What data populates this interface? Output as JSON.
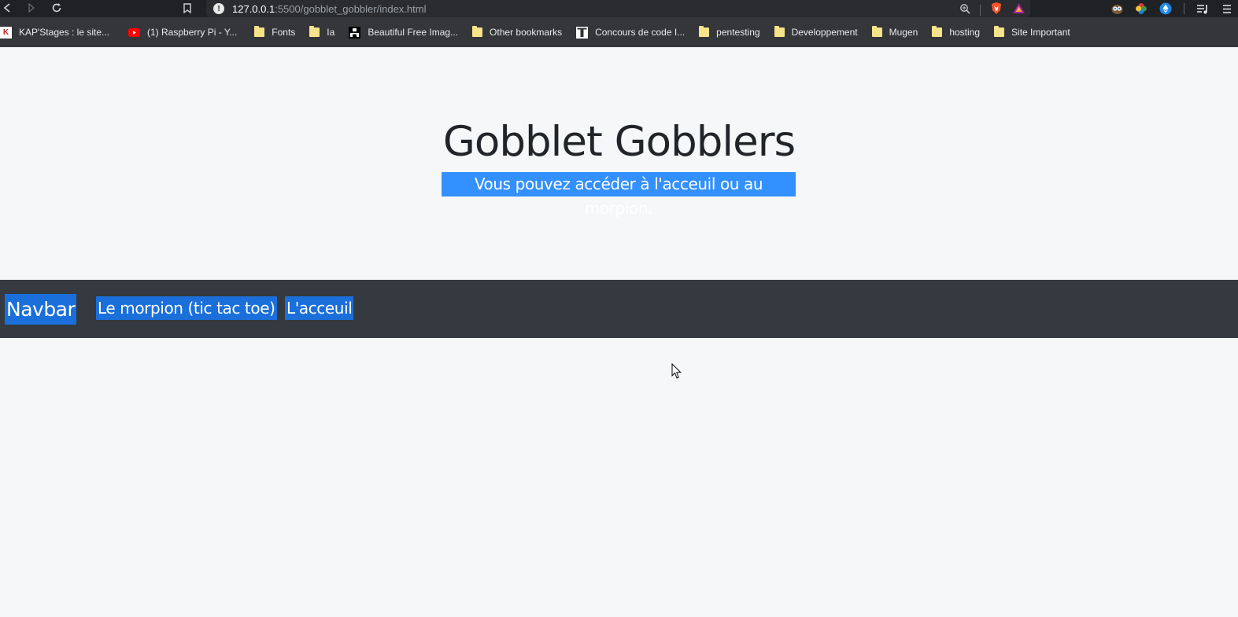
{
  "browser": {
    "url_host": "127.0.0.1",
    "url_rest": ":5500/gobblet_gobbler/index.html",
    "icons": {
      "back": "back-arrow-icon",
      "forward": "forward-arrow-icon",
      "reload": "reload-icon",
      "bookmark": "bookmark-icon",
      "info": "info-icon",
      "zoom": "zoom-icon",
      "brave": "brave-shield-icon",
      "rewards": "brave-rewards-icon",
      "extensions": [
        "owl-extension-icon",
        "color-wheel-extension-icon",
        "ethereum-wallet-icon"
      ],
      "playlist": "playlist-icon",
      "menu": "menu-icon"
    }
  },
  "bookmarks": [
    {
      "label": "KAP'Stages : le site...",
      "icon": "kap-favicon"
    },
    {
      "label": "(1) Raspberry Pi - Y...",
      "icon": "youtube-favicon"
    },
    {
      "label": "Fonts",
      "icon": "folder-icon"
    },
    {
      "label": "Ia",
      "icon": "folder-icon"
    },
    {
      "label": "Beautiful Free Imag...",
      "icon": "unsplash-favicon"
    },
    {
      "label": "Other bookmarks",
      "icon": "folder-icon"
    },
    {
      "label": "Concours de code I...",
      "icon": "site-favicon"
    },
    {
      "label": "pentesting",
      "icon": "folder-icon"
    },
    {
      "label": "Developpement",
      "icon": "folder-icon"
    },
    {
      "label": "Mugen",
      "icon": "folder-icon"
    },
    {
      "label": "hosting",
      "icon": "folder-icon"
    },
    {
      "label": "Site Important",
      "icon": "folder-icon"
    }
  ],
  "page": {
    "title": "Gobblet Gobblers",
    "subtitle": "Vous pouvez accéder à l'acceuil ou au morpion.",
    "navbar": {
      "brand": "Navbar",
      "links": [
        "Le morpion (tic tac toe)",
        "L'acceuil"
      ]
    }
  },
  "colors": {
    "page_bg": "#f6f7f9",
    "navbar_bg": "#343a40",
    "selection": "#3390ff",
    "link_highlight": "#1a6fdb",
    "title": "#212529"
  }
}
